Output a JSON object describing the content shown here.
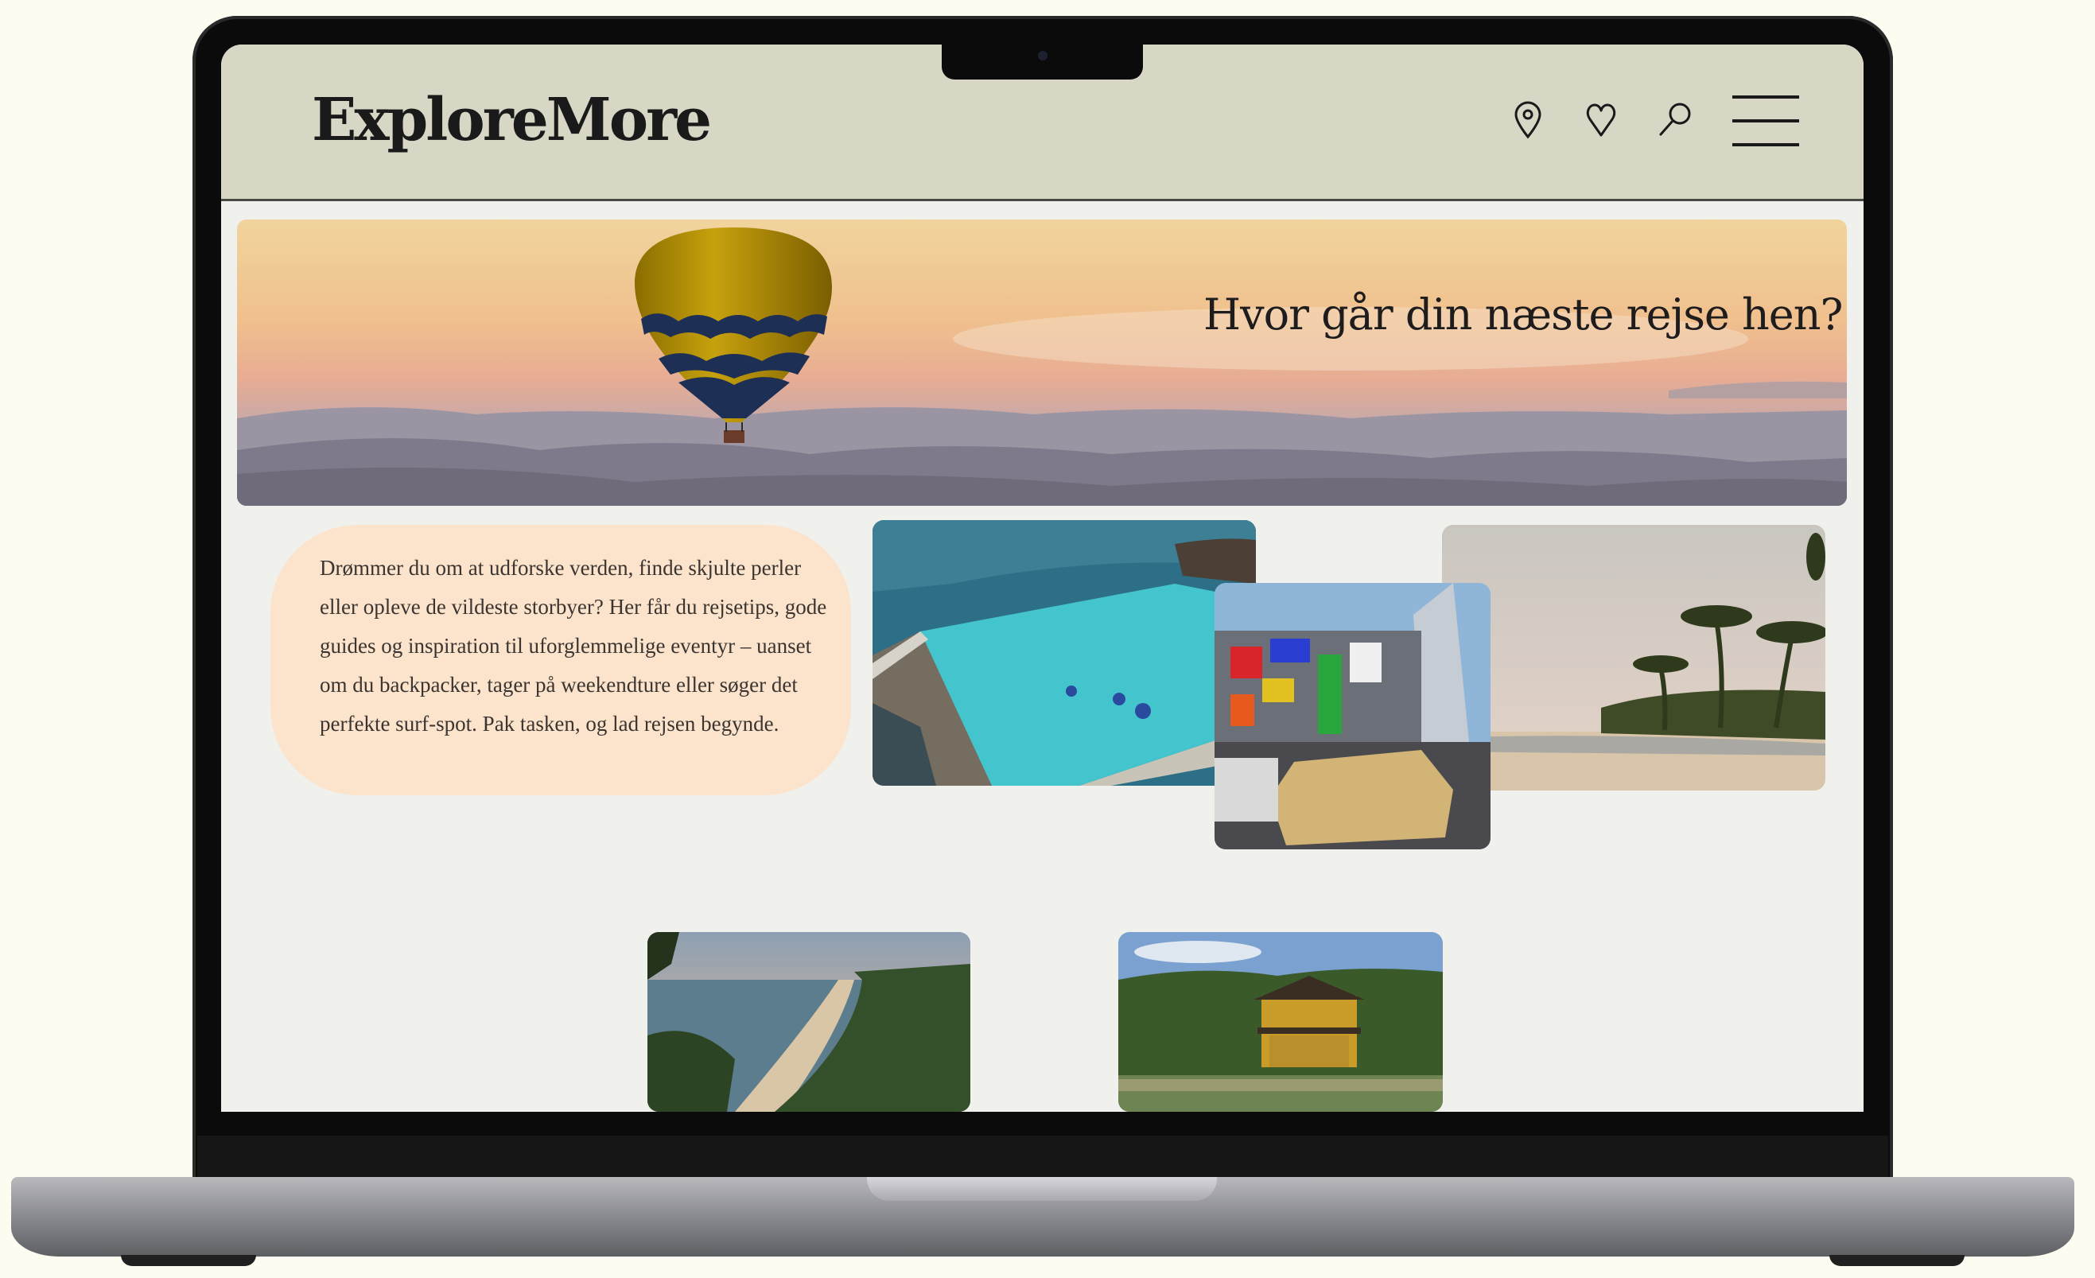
{
  "site": {
    "logo": "ExploreMore",
    "nav_icons": [
      "location-pin-icon",
      "heart-icon",
      "search-icon",
      "menu-icon"
    ]
  },
  "hero": {
    "title": "Hvor går din næste rejse hen?"
  },
  "intro": {
    "text": "Drømmer du om at udforske verden, finde skjulte perler eller opleve de vildeste storbyer? Her får du rejsetips, gode guides og inspiration til uforglemmelige eventyr – uanset om du backpacker, tager på weekendture eller søger det perfekte surf-spot. Pak tasken, og lad rejsen begynde."
  },
  "colors": {
    "header_bg": "#d8d6c5",
    "intro_bg": "#fce3cc",
    "page_bg": "#f0f0ec"
  }
}
